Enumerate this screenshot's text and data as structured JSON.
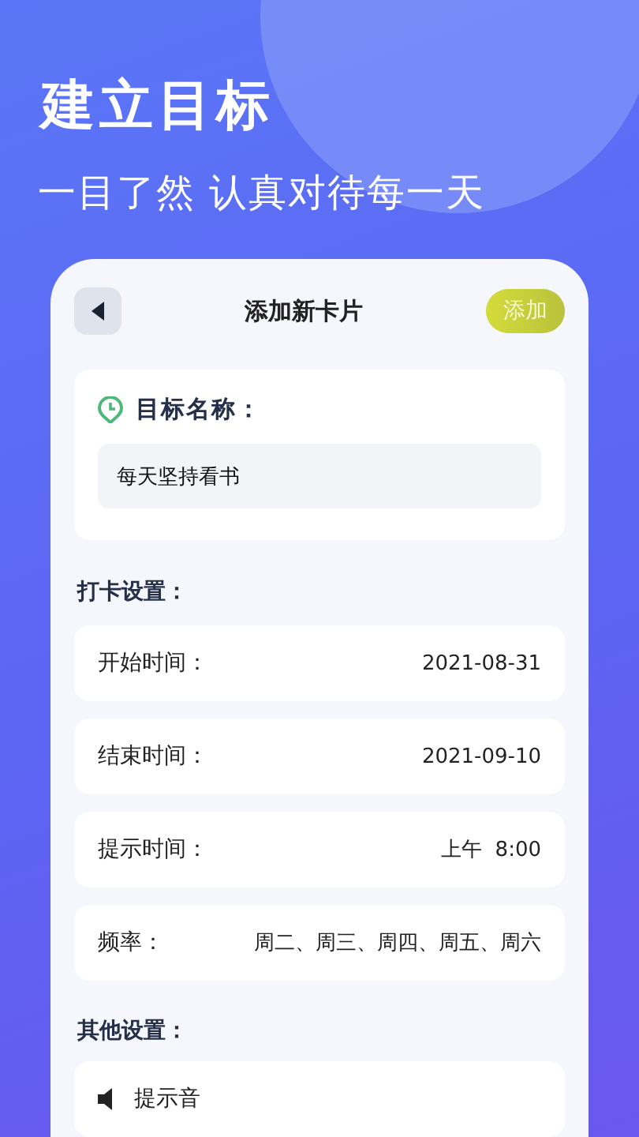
{
  "headline": "建立目标",
  "tagline": "一目了然 认真对待每一天",
  "header": {
    "title": "添加新卡片",
    "action": "添加"
  },
  "goal": {
    "label": "目标名称：",
    "value": "每天坚持看书"
  },
  "checkin_section": {
    "title": "打卡设置：",
    "rows": [
      {
        "label": "开始时间：",
        "value": "2021-08-31"
      },
      {
        "label": "结束时间：",
        "value": "2021-09-10"
      },
      {
        "label": "提示时间：",
        "value": "上午  8:00"
      },
      {
        "label": "频率：",
        "value": "周二、周三、周四、周五、周六"
      }
    ]
  },
  "other_section": {
    "title": "其他设置：",
    "rows": [
      {
        "label": "提示音"
      }
    ]
  }
}
